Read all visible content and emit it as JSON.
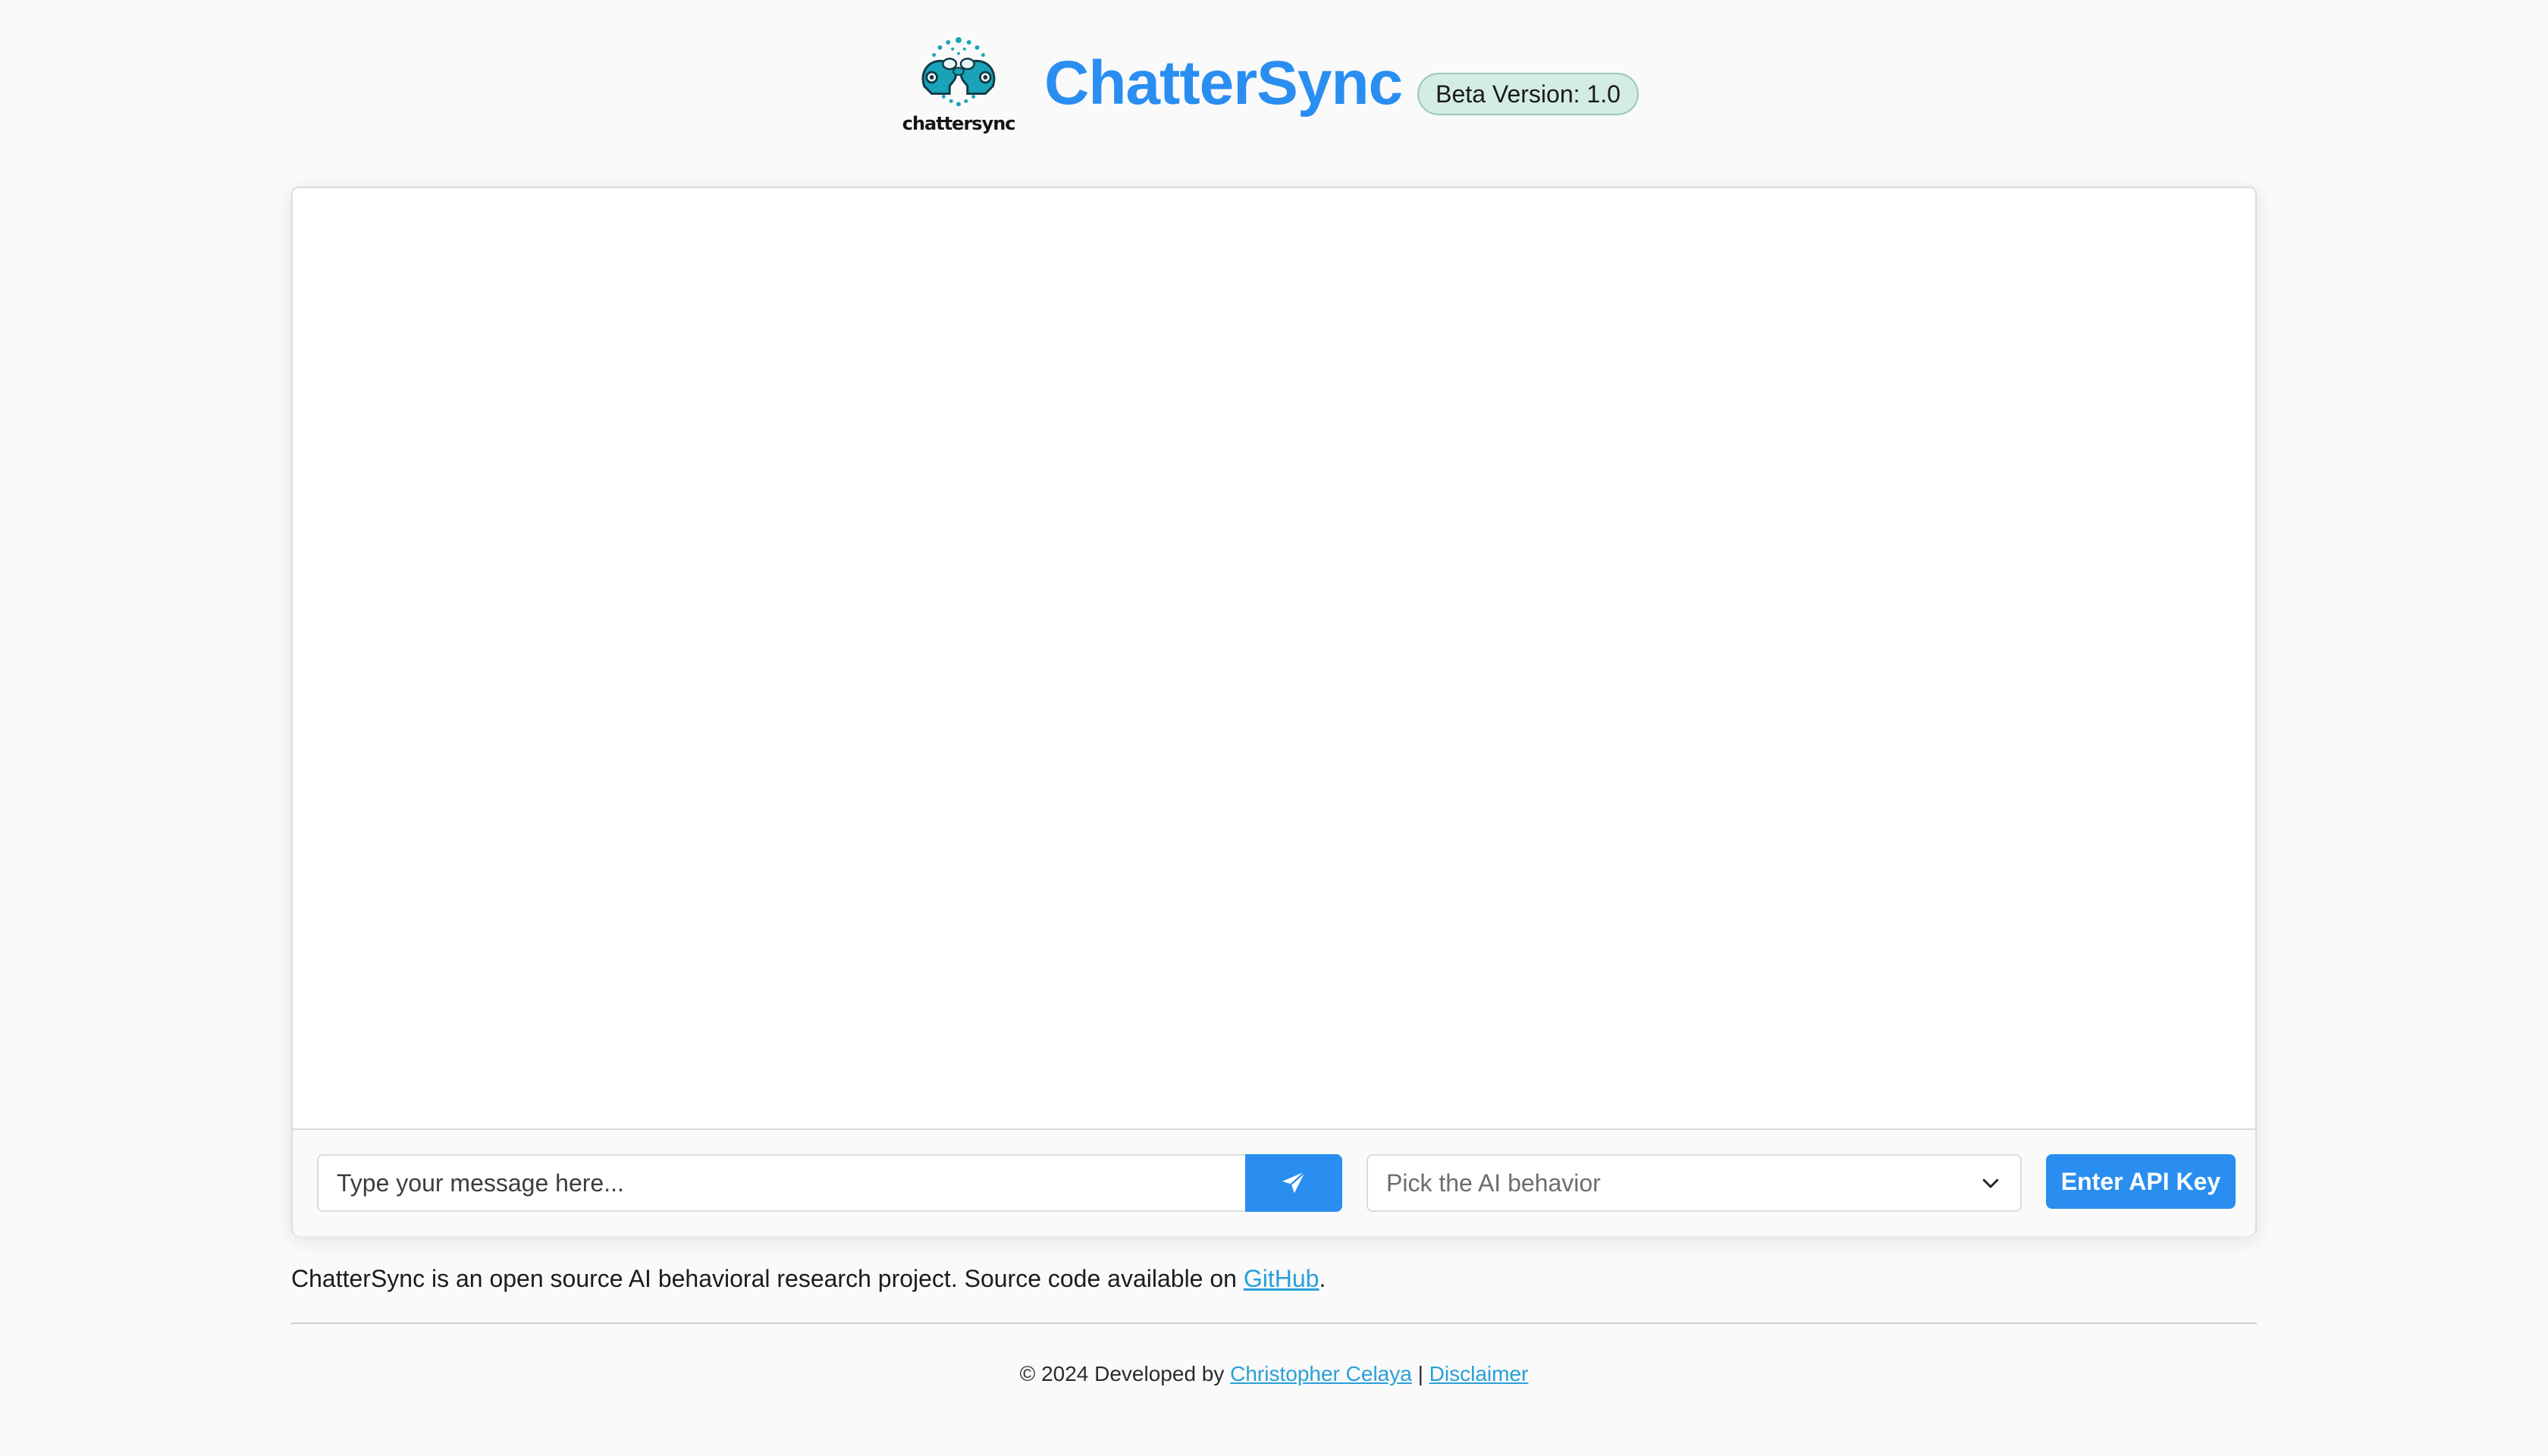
{
  "header": {
    "logo_text": "chattersync",
    "title": "ChatterSync",
    "badge": "Beta Version: 1.0"
  },
  "chat": {
    "message_placeholder": "Type your message here...",
    "send_icon": "paper-plane-icon",
    "behavior_placeholder": "Pick the AI behavior",
    "dropdown_icon": "chevron-down-icon",
    "api_key_label": "Enter API Key"
  },
  "info": {
    "text_before": "ChatterSync is an open source AI behavioral research project. Source code available on ",
    "github_link": "GitHub",
    "text_after": "."
  },
  "footer": {
    "copyright": "© 2024 Developed by ",
    "author_link": "Christopher Celaya",
    "separator": " | ",
    "disclaimer_link": "Disclaimer"
  },
  "colors": {
    "accent": "#2a8ef1",
    "link": "#2a9fd8",
    "badge_bg": "#d3ece4",
    "logo_teal": "#1aa3b8"
  }
}
